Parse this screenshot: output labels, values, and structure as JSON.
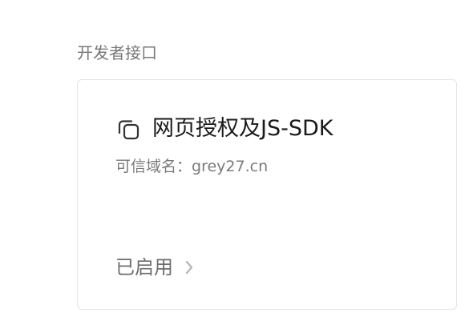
{
  "section": {
    "title": "开发者接口"
  },
  "card": {
    "icon": "copy-windows-icon",
    "title": "网页授权及JS-SDK",
    "domain_label": "可信域名：",
    "domain_value": "grey27.cn",
    "status": "已启用",
    "status_icon": "chevron-right-icon"
  },
  "colors": {
    "title_text": "#1a1a1a",
    "secondary_text": "#7a7a7a",
    "border": "#e4e4e4",
    "icon_stroke": "#333333",
    "chevron": "#b5b5b5"
  }
}
